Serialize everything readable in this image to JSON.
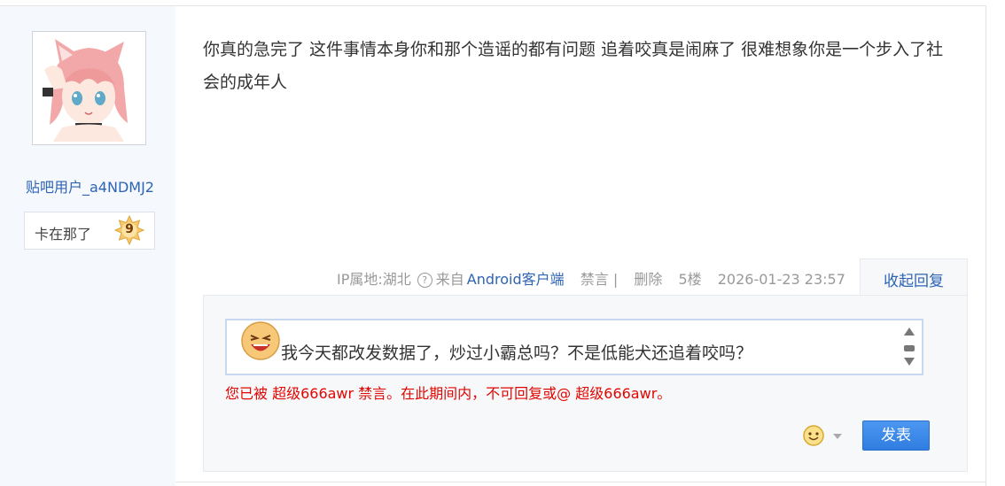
{
  "author": {
    "username": "贴吧用户_a4NDMJ2",
    "level_title": "卡在那了",
    "level": "9",
    "avatar_icon": "anime-catgirl-avatar"
  },
  "post": {
    "content": "你真的急完了 这件事情本身你和那个造谣的都有问题 追着咬真是闹麻了 很难想象你是一个步入了社会的成年人"
  },
  "tail": {
    "ip_location": "IP属地:湖北",
    "from_prefix": "来自",
    "client": "Android客户端",
    "ban": "禁言 |",
    "delete": "删除",
    "floor": "5楼",
    "datetime": "2026-01-23 23:57"
  },
  "reply_toggle": "收起回复",
  "editor": {
    "text": "我今天都改发数据了，炒过小霸总吗？不是低能犬还追着咬吗？",
    "emoji_icon": "laughing-emoji-icon"
  },
  "ban_notice": "您已被 超级666awr 禁言。在此期间内，不可回复或@ 超级666awr。",
  "submit_label": "发表",
  "colors": {
    "link": "#2d64b3",
    "warning": "#e10601",
    "button": "#3385e8",
    "sidebar_bg": "#f5f8fd"
  }
}
